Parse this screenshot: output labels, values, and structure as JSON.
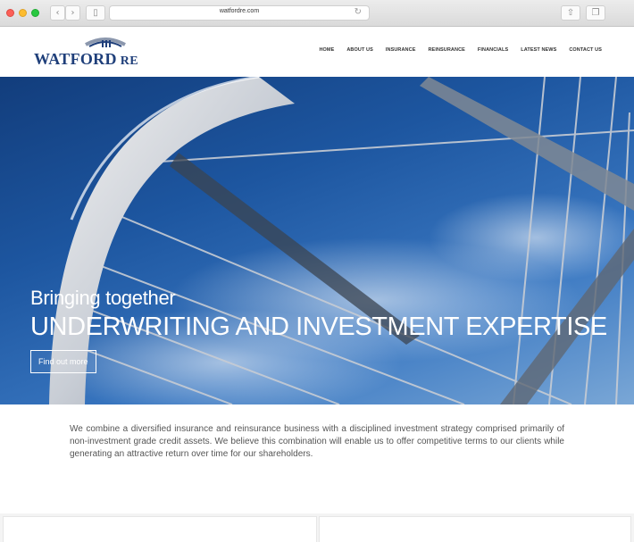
{
  "browser": {
    "url": "watfordre.com",
    "back_icon": "chevron-left-icon",
    "forward_icon": "chevron-right-icon",
    "sidebar_icon": "sidebar-icon",
    "reload_icon": "reload-icon",
    "share_icon": "share-icon",
    "tabs_icon": "tabs-icon"
  },
  "site": {
    "logo_main": "WATFORD",
    "logo_suffix": "RE",
    "brand_color": "#1f3f7a",
    "nav": [
      "HOME",
      "ABOUT US",
      "INSURANCE",
      "REINSURANCE",
      "FINANCIALS",
      "LATEST NEWS",
      "CONTACT US"
    ]
  },
  "hero": {
    "kicker": "Bringing together",
    "title": "UNDERWRITING AND INVESTMENT EXPERTISE",
    "cta": "Find out more"
  },
  "intro": {
    "text": "We combine a diversified insurance and reinsurance business with a disciplined investment strategy comprised primarily of non-investment grade credit assets. We believe this combination will enable us to offer competitive terms to our clients while generating an attractive return over time for our shareholders."
  }
}
